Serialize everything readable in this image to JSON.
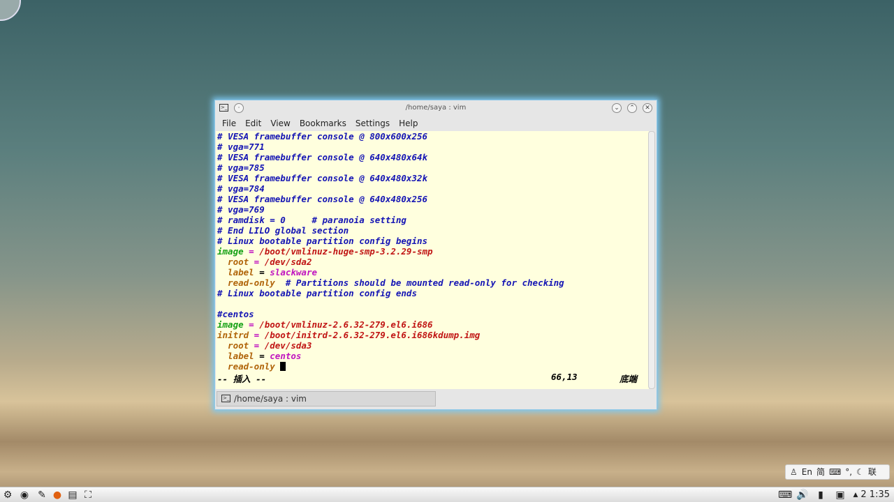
{
  "window": {
    "title": "/home/saya : vim",
    "tab_label": "/home/saya : vim"
  },
  "menu": [
    "File",
    "Edit",
    "View",
    "Bookmarks",
    "Settings",
    "Help"
  ],
  "colors": {
    "comment": "#1414b4",
    "keyword": "#14a014",
    "value": "#c01414",
    "option": "#b0640a",
    "string": "#c014c0",
    "plain": "#000000"
  },
  "lines": [
    [
      [
        "comment",
        "# VESA framebuffer console @ 800x600x256"
      ]
    ],
    [
      [
        "comment",
        "# vga=771"
      ]
    ],
    [
      [
        "comment",
        "# VESA framebuffer console @ 640x480x64k"
      ]
    ],
    [
      [
        "comment",
        "# vga=785"
      ]
    ],
    [
      [
        "comment",
        "# VESA framebuffer console @ 640x480x32k"
      ]
    ],
    [
      [
        "comment",
        "# vga=784"
      ]
    ],
    [
      [
        "comment",
        "# VESA framebuffer console @ 640x480x256"
      ]
    ],
    [
      [
        "comment",
        "# vga=769"
      ]
    ],
    [
      [
        "comment",
        "# ramdisk = 0     # paranoia setting"
      ]
    ],
    [
      [
        "comment",
        "# End LILO global section"
      ]
    ],
    [
      [
        "comment",
        "# Linux bootable partition config begins"
      ]
    ],
    [
      [
        "keyword",
        "image"
      ],
      [
        "string",
        " = "
      ],
      [
        "value",
        "/boot/vmlinuz-huge-smp-3.2.29-smp"
      ]
    ],
    [
      [
        "option",
        "  root"
      ],
      [
        "string",
        " = "
      ],
      [
        "value",
        "/dev/sda2"
      ]
    ],
    [
      [
        "option",
        "  label"
      ],
      [
        "plain",
        " = "
      ],
      [
        "string",
        "slackware"
      ]
    ],
    [
      [
        "option",
        "  read-only"
      ],
      [
        "comment",
        "  # Partitions should be mounted read-only for checking"
      ]
    ],
    [
      [
        "comment",
        "# Linux bootable partition config ends"
      ]
    ],
    [
      [
        "plain",
        " "
      ]
    ],
    [
      [
        "comment",
        "#centos"
      ]
    ],
    [
      [
        "keyword",
        "image"
      ],
      [
        "string",
        " = "
      ],
      [
        "value",
        "/boot/vmlinuz-2.6.32-279.el6.i686"
      ]
    ],
    [
      [
        "option",
        "initrd"
      ],
      [
        "string",
        " = "
      ],
      [
        "value",
        "/boot/initrd-2.6.32-279.el6.i686kdump.img"
      ]
    ],
    [
      [
        "option",
        "  root"
      ],
      [
        "string",
        " = "
      ],
      [
        "value",
        "/dev/sda3"
      ]
    ],
    [
      [
        "option",
        "  label"
      ],
      [
        "plain",
        " = "
      ],
      [
        "string",
        "centos"
      ]
    ],
    [
      [
        "option",
        "  read-only "
      ]
    ]
  ],
  "status": {
    "mode": "-- 插入 --",
    "position": "66,13",
    "scroll": "底端"
  },
  "ime": {
    "lang": "En",
    "mode": "简",
    "punct": "°,",
    "extra": "联"
  },
  "clock": "2 1:35"
}
